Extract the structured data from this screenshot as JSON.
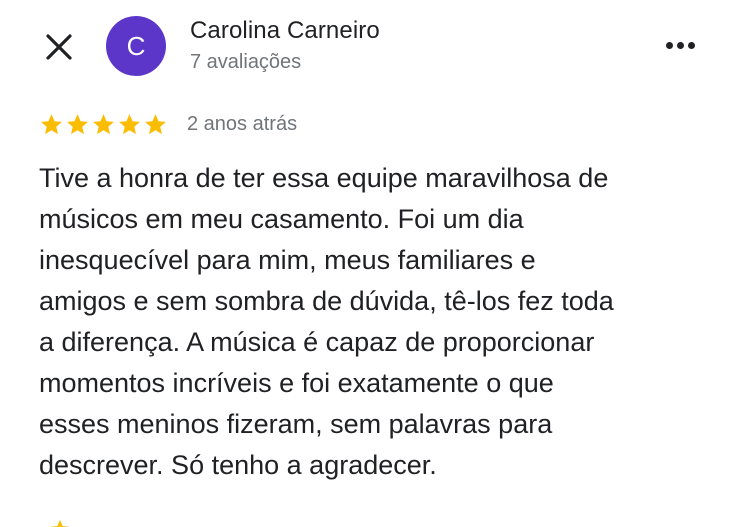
{
  "reviewer": {
    "avatar_initial": "C",
    "avatar_color": "#5c35c9",
    "name": "Carolina Carneiro",
    "review_count": "7 avaliações"
  },
  "rating": {
    "stars": 5,
    "max_stars": 5,
    "star_color": "#fbbc04",
    "date": "2 anos atrás"
  },
  "review": {
    "text": "Tive a honra de ter essa equipe maravilhosa de\nmúsicos em meu casamento. Foi um dia\ninesquecível para mim, meus familiares e\namigos e sem sombra de dúvida, tê-los fez toda\na diferença. A música é capaz de proporcionar\nmomentos incríveis e foi exatamente o que\nesses meninos fizeram, sem palavras para\ndescrever. Só tenho a agradecer."
  },
  "icons": {
    "close": "close-icon",
    "more": "more-horizontal-icon",
    "star": "star-icon"
  }
}
